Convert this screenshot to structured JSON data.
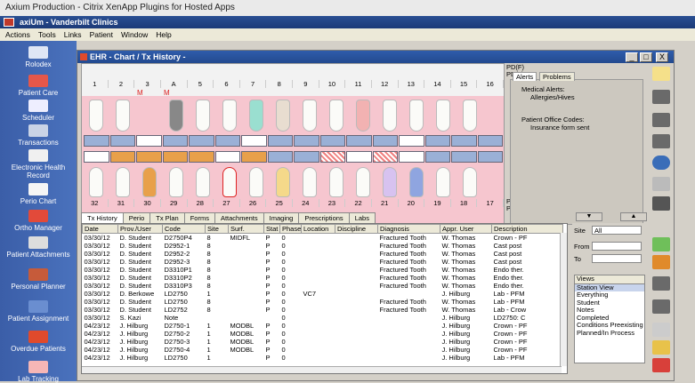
{
  "outer_title": "Axium Production - Citrix XenApp Plugins for Hosted Apps",
  "app_title": "axiUm - Vanderbilt Clinics",
  "menu": [
    "Actions",
    "Tools",
    "Links",
    "Patient",
    "Window",
    "Help"
  ],
  "sidebar": [
    {
      "label": "Rolodex",
      "icon": "rolodex-icon"
    },
    {
      "label": "Patient Care",
      "icon": "patient-care-icon"
    },
    {
      "label": "Scheduler",
      "icon": "scheduler-icon"
    },
    {
      "label": "Transactions",
      "icon": "transactions-icon"
    },
    {
      "label": "Electronic Health Record",
      "icon": "ehr-icon"
    },
    {
      "label": "Perio Chart",
      "icon": "perio-chart-icon"
    },
    {
      "label": "Ortho Manager",
      "icon": "ortho-manager-icon"
    },
    {
      "label": "Patient Attachments",
      "icon": "attachments-icon"
    },
    {
      "label": "Personal Planner",
      "icon": "planner-icon"
    },
    {
      "label": "Patient Assignment",
      "icon": "assignment-icon"
    },
    {
      "label": "Overdue Patients",
      "icon": "overdue-icon"
    },
    {
      "label": "Lab Tracking",
      "icon": "lab-tracking-icon"
    }
  ],
  "window_title": "EHR - Chart / Tx History -",
  "win_buttons": [
    "_",
    "□",
    "X"
  ],
  "pd_labels": {
    "top1": "PD(F)",
    "top2": "PD(L)",
    "bottom1": "PD(L)",
    "bottom2": "PD(F)"
  },
  "upper_teeth": [
    "1",
    "2",
    "3",
    "A",
    "5",
    "6",
    "7",
    "8",
    "9",
    "10",
    "11",
    "12",
    "13",
    "14",
    "15",
    "16"
  ],
  "lower_teeth": [
    "32",
    "31",
    "30",
    "29",
    "28",
    "27",
    "26",
    "25",
    "24",
    "23",
    "22",
    "21",
    "20",
    "19",
    "18",
    "17"
  ],
  "missing_marks": [
    "M",
    "M"
  ],
  "alerts": {
    "tabs": [
      "Alerts",
      "Problems"
    ],
    "lines": [
      "Medical Alerts:",
      "Allergies/Hives",
      "Patient Office Codes:",
      "Insurance form sent"
    ]
  },
  "tabs": [
    "Tx History",
    "Perio",
    "Tx Plan",
    "Forms",
    "Attachments",
    "Imaging",
    "Prescriptions",
    "Labs"
  ],
  "table": {
    "columns": [
      "Date",
      "Prov./User",
      "Code",
      "Site",
      "Surf.",
      "Stat",
      "Phase",
      "Location",
      "Discipline",
      "Diagnosis",
      "Appr. User",
      "Description"
    ],
    "rows": [
      [
        "03/30/12",
        "D. Student",
        "D2750P4",
        "8",
        "MIDFL",
        "P",
        "0",
        "",
        "",
        "Fractured Tooth",
        "W. Thomas",
        "Crown - PF"
      ],
      [
        "03/30/12",
        "D. Student",
        "D2952-1",
        "8",
        "",
        "P",
        "0",
        "",
        "",
        "Fractured Tooth",
        "W. Thomas",
        "Cast post"
      ],
      [
        "03/30/12",
        "D. Student",
        "D2952-2",
        "8",
        "",
        "P",
        "0",
        "",
        "",
        "Fractured Tooth",
        "W. Thomas",
        "Cast post"
      ],
      [
        "03/30/12",
        "D. Student",
        "D2952-3",
        "8",
        "",
        "P",
        "0",
        "",
        "",
        "Fractured Tooth",
        "W. Thomas",
        "Cast post"
      ],
      [
        "03/30/12",
        "D. Student",
        "D3310P1",
        "8",
        "",
        "P",
        "0",
        "",
        "",
        "Fractured Tooth",
        "W. Thomas",
        "Endo ther."
      ],
      [
        "03/30/12",
        "D. Student",
        "D3310P2",
        "8",
        "",
        "P",
        "0",
        "",
        "",
        "Fractured Tooth",
        "W. Thomas",
        "Endo ther."
      ],
      [
        "03/30/12",
        "D. Student",
        "D3310P3",
        "8",
        "",
        "P",
        "0",
        "",
        "",
        "Fractured Tooth",
        "W. Thomas",
        "Endo ther."
      ],
      [
        "03/30/12",
        "D. Berkowe",
        "LD2750",
        "1",
        "",
        "P",
        "0",
        "VC7",
        "",
        "",
        "J. Hilburg",
        "Lab - PFM"
      ],
      [
        "03/30/12",
        "D. Student",
        "LD2750",
        "8",
        "",
        "P",
        "0",
        "",
        "",
        "Fractured Tooth",
        "W. Thomas",
        "Lab - PFM"
      ],
      [
        "03/30/12",
        "D. Student",
        "LD2752",
        "8",
        "",
        "P",
        "0",
        "",
        "",
        "Fractured Tooth",
        "W. Thomas",
        "Lab - Crow"
      ],
      [
        "03/30/12",
        "S. Kazi",
        "Note",
        "",
        "",
        "",
        "0",
        "",
        "",
        "",
        "J. Hilburg",
        "LD2750: C"
      ],
      [
        "04/23/12",
        "J. Hilburg",
        "D2750-1",
        "1",
        "MODBL",
        "P",
        "0",
        "",
        "",
        "",
        "J. Hilburg",
        "Crown - PF"
      ],
      [
        "04/23/12",
        "J. Hilburg",
        "D2750-2",
        "1",
        "MODBL",
        "P",
        "0",
        "",
        "",
        "",
        "J. Hilburg",
        "Crown - PF"
      ],
      [
        "04/23/12",
        "J. Hilburg",
        "D2750-3",
        "1",
        "MODBL",
        "P",
        "0",
        "",
        "",
        "",
        "J. Hilburg",
        "Crown - PF"
      ],
      [
        "04/23/12",
        "J. Hilburg",
        "D2750-4",
        "1",
        "MODBL",
        "P",
        "0",
        "",
        "",
        "",
        "J. Hilburg",
        "Crown - PF"
      ],
      [
        "04/23/12",
        "J. Hilburg",
        "LD2750",
        "1",
        "",
        "P",
        "0",
        "",
        "",
        "",
        "J. Hilburg",
        "Lab - PFM"
      ]
    ]
  },
  "filter": {
    "site_label": "Site",
    "site_value": "All",
    "from_label": "From",
    "to_label": "To"
  },
  "views": {
    "header": "Views",
    "items": [
      "Station View",
      "Everything",
      "Student",
      "Notes",
      "Completed",
      "Conditions Preexisting",
      "Planned/In Process"
    ]
  }
}
